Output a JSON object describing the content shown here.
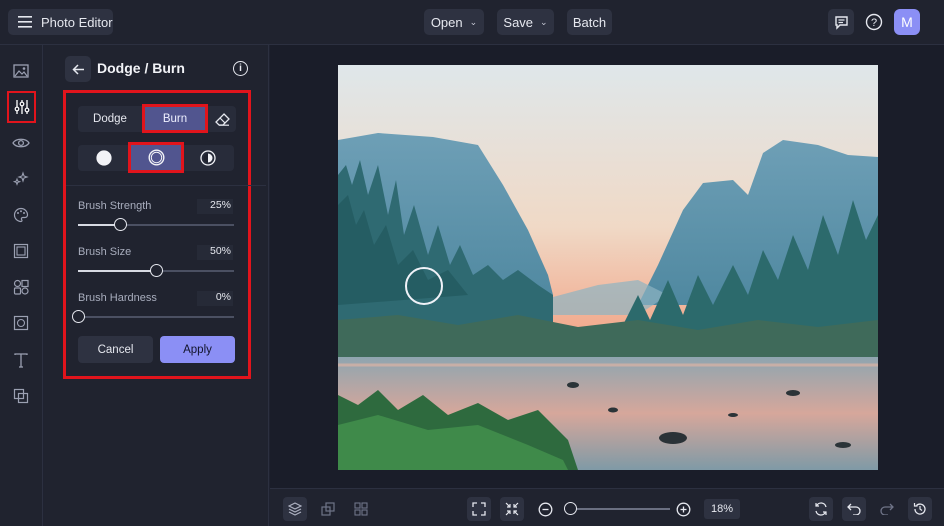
{
  "topbar": {
    "app_title": "Photo Editor",
    "open_label": "Open",
    "save_label": "Save",
    "batch_label": "Batch",
    "avatar_initial": "M"
  },
  "rail": {
    "items": [
      "image-icon",
      "adjust-sliders-icon",
      "eye-icon",
      "sparkle-effects-icon",
      "palette-icon",
      "frame-icon",
      "shapes-icon",
      "texture-icon",
      "text-icon",
      "overlay-icon"
    ],
    "active": "adjust-sliders-icon"
  },
  "panel": {
    "title": "Dodge / Burn",
    "modes": {
      "dodge": "Dodge",
      "burn": "Burn",
      "selected": "Burn"
    },
    "tones": [
      "shadows",
      "midtones",
      "highlights"
    ],
    "selected_tone": "midtones",
    "sliders": [
      {
        "label": "Brush Strength",
        "value": "25%",
        "fraction": 0.27
      },
      {
        "label": "Brush Size",
        "value": "50%",
        "fraction": 0.5
      },
      {
        "label": "Brush Hardness",
        "value": "0%",
        "fraction": 0.0
      }
    ],
    "cancel_label": "Cancel",
    "apply_label": "Apply"
  },
  "bottombar": {
    "zoom_value": "18%"
  },
  "colors": {
    "accent": "#8b8ff5",
    "highlight": "#e1141c",
    "selected_segment": "#51558f"
  }
}
